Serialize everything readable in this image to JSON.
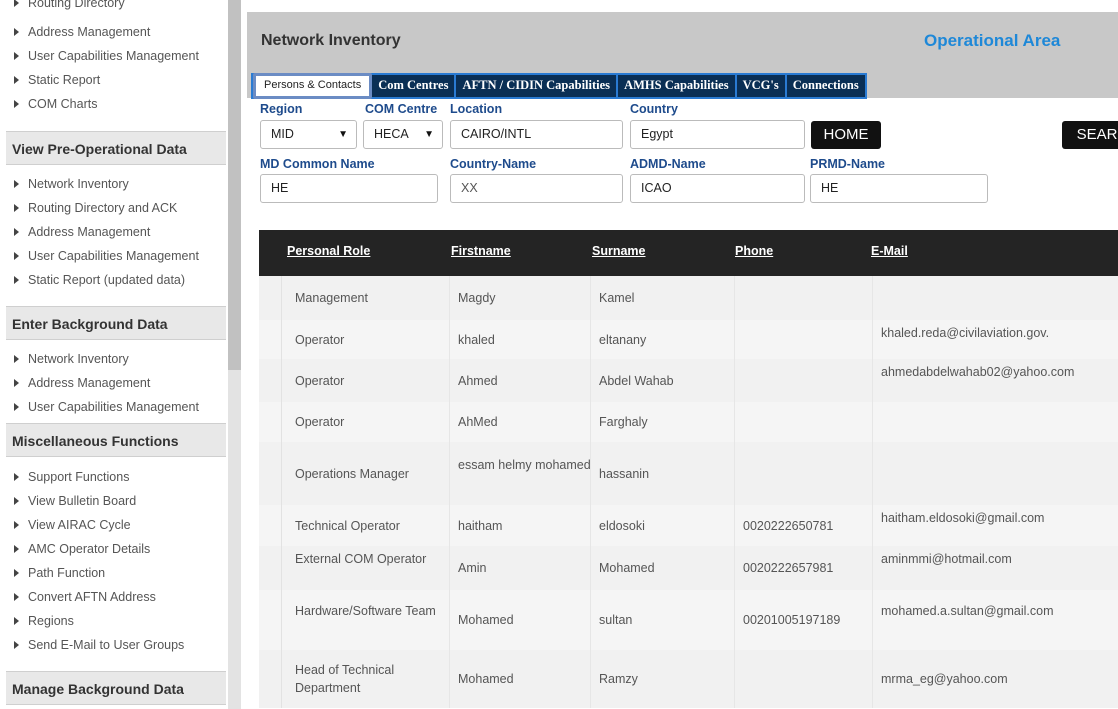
{
  "sidebar": {
    "group1": [
      "Routing Directory",
      "Address Management",
      "User Capabilities Management",
      "Static Report",
      "COM Charts"
    ],
    "head2": "View Pre-Operational Data",
    "group2": [
      "Network Inventory",
      "Routing Directory and ACK",
      "Address Management",
      "User Capabilities Management",
      "Static Report (updated data)"
    ],
    "head3": "Enter Background Data",
    "group3": [
      "Network Inventory",
      "Address Management",
      "User Capabilities Management"
    ],
    "head4": "Miscellaneous Functions",
    "group4": [
      "Support Functions",
      "View Bulletin Board",
      "View AIRAC Cycle",
      "AMC Operator Details",
      "Path Function",
      "Convert AFTN Address",
      "Regions",
      "Send E-Mail to User Groups"
    ],
    "head5": "Manage Background Data"
  },
  "header": {
    "title": "Network Inventory",
    "area": "Operational Area"
  },
  "tabs": [
    "Persons & Contacts",
    "Com Centres",
    "AFTN / CIDIN Capabilities",
    "AMHS Capabilities",
    "VCG's",
    "Connections"
  ],
  "filters": {
    "region_label": "Region",
    "region_value": "MID",
    "comcentre_label": "COM Centre",
    "comcentre_value": "HECA",
    "location_label": "Location",
    "location_value": "CAIRO/INTL",
    "country_label": "Country",
    "country_value": "Egypt",
    "home_button": "HOME",
    "search_button": "SEAR",
    "md_label": "MD Common Name",
    "md_value": "HE",
    "countryname_label": "Country-Name",
    "countryname_value": "XX",
    "admd_label": "ADMD-Name",
    "admd_value": "ICAO",
    "prmd_label": "PRMD-Name",
    "prmd_value": "HE"
  },
  "table": {
    "columns": [
      "Personal Role",
      "Firstname",
      "Surname",
      "Phone",
      "E-Mail"
    ],
    "rows": [
      [
        "Management",
        "Magdy",
        "Kamel",
        "",
        ""
      ],
      [
        "Operator",
        "khaled",
        "eltanany",
        "",
        "khaled.reda@civilaviation.gov."
      ],
      [
        "Operator",
        "Ahmed",
        "Abdel Wahab",
        "",
        "ahmedabdelwahab02@yahoo.com"
      ],
      [
        "Operator",
        "AhMed",
        "Farghaly",
        "",
        ""
      ],
      [
        "Operations Manager",
        "essam helmy mohamed",
        "hassanin",
        "",
        ""
      ],
      [
        "Technical Operator",
        "haitham",
        "eldosoki",
        "0020222650781",
        "haitham.eldosoki@gmail.com"
      ],
      [
        "External COM Operator",
        "Amin",
        "Mohamed",
        "0020222657981",
        "aminmmi@hotmail.com"
      ],
      [
        "Hardware/Software Team",
        "Mohamed",
        "sultan",
        "00201005197189",
        "mohamed.a.sultan@gmail.com"
      ],
      [
        "Head of Technical Department",
        "Mohamed",
        "Ramzy",
        "",
        "mrma_eg@yahoo.com"
      ]
    ]
  }
}
